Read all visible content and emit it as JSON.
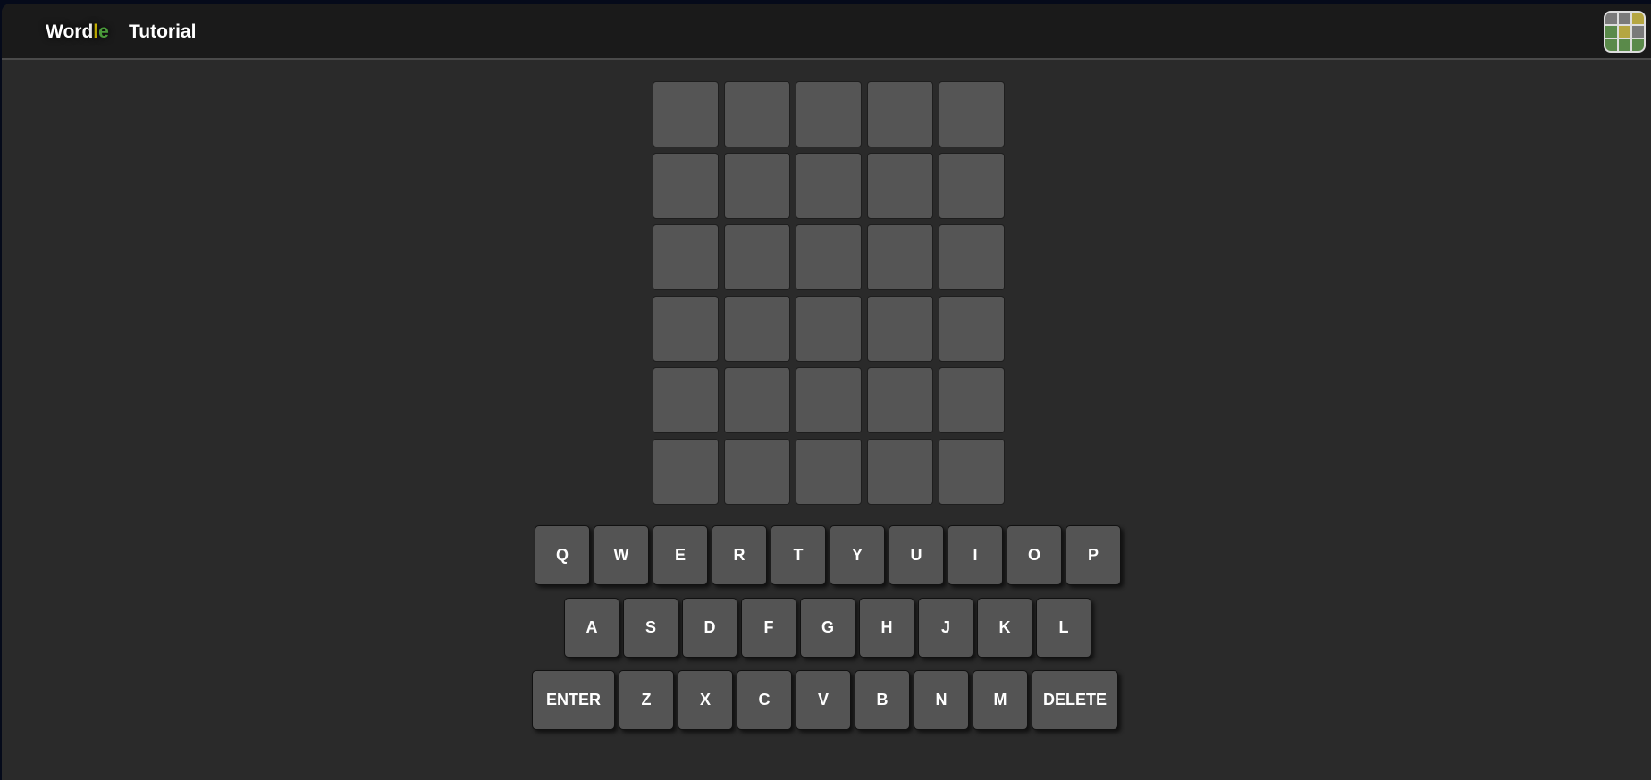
{
  "header": {
    "logo_parts": [
      "Word",
      "l",
      "e"
    ],
    "tutorial_label": "Tutorial",
    "stats_icon": "stats-grid-icon"
  },
  "board": {
    "rows": 6,
    "cols": 5
  },
  "keyboard": {
    "row1": [
      "Q",
      "W",
      "E",
      "R",
      "T",
      "Y",
      "U",
      "I",
      "O",
      "P"
    ],
    "row2": [
      "A",
      "S",
      "D",
      "F",
      "G",
      "H",
      "J",
      "K",
      "L"
    ],
    "row3": [
      "ENTER",
      "Z",
      "X",
      "C",
      "V",
      "B",
      "N",
      "M",
      "DELETE"
    ]
  },
  "colors": {
    "background": "#2a2a2a",
    "header": "#1a1a1a",
    "tile": "#555555",
    "key": "#545454",
    "present": "#b5a642",
    "correct": "#5a8a4a",
    "absent": "#7a7a7a"
  }
}
